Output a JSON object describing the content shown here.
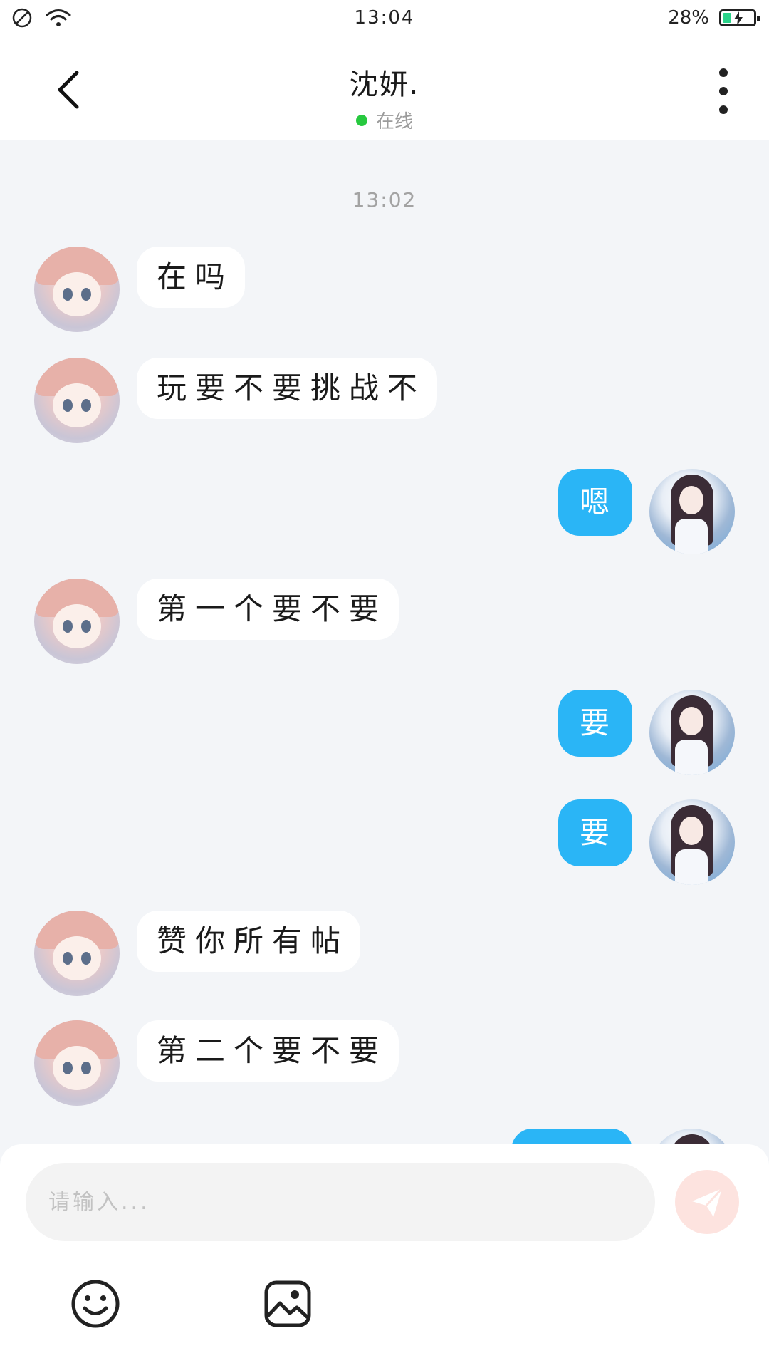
{
  "status_bar": {
    "time": "13:04",
    "battery_percent": "28%",
    "battery_level": 0.28,
    "icons": [
      "do-not-disturb-icon",
      "wifi-icon",
      "battery-charging-icon"
    ]
  },
  "header": {
    "title": "沈妍.",
    "presence": "在线",
    "presence_color": "#27c93f",
    "icons": [
      "back-arrow-icon",
      "more-vertical-icon"
    ]
  },
  "conversation": {
    "timestamp": "13:02",
    "messages": [
      {
        "from": "them",
        "text": "在吗"
      },
      {
        "from": "them",
        "text": "玩要不要挑战不"
      },
      {
        "from": "me",
        "text": "嗯"
      },
      {
        "from": "them",
        "text": "第一个要不要"
      },
      {
        "from": "me",
        "text": "要"
      },
      {
        "from": "me",
        "text": "要"
      },
      {
        "from": "them",
        "text": "赞你所有帖"
      },
      {
        "from": "them",
        "text": "第二个要不要"
      }
    ]
  },
  "composer": {
    "placeholder": "请输入...",
    "value": "",
    "icons": [
      "send-icon",
      "emoji-icon",
      "image-icon"
    ]
  },
  "colors": {
    "outgoing_bubble": "#2ab5f6",
    "incoming_bubble": "#ffffff",
    "chat_background": "#f3f5f8",
    "send_button": "#fde3df"
  }
}
